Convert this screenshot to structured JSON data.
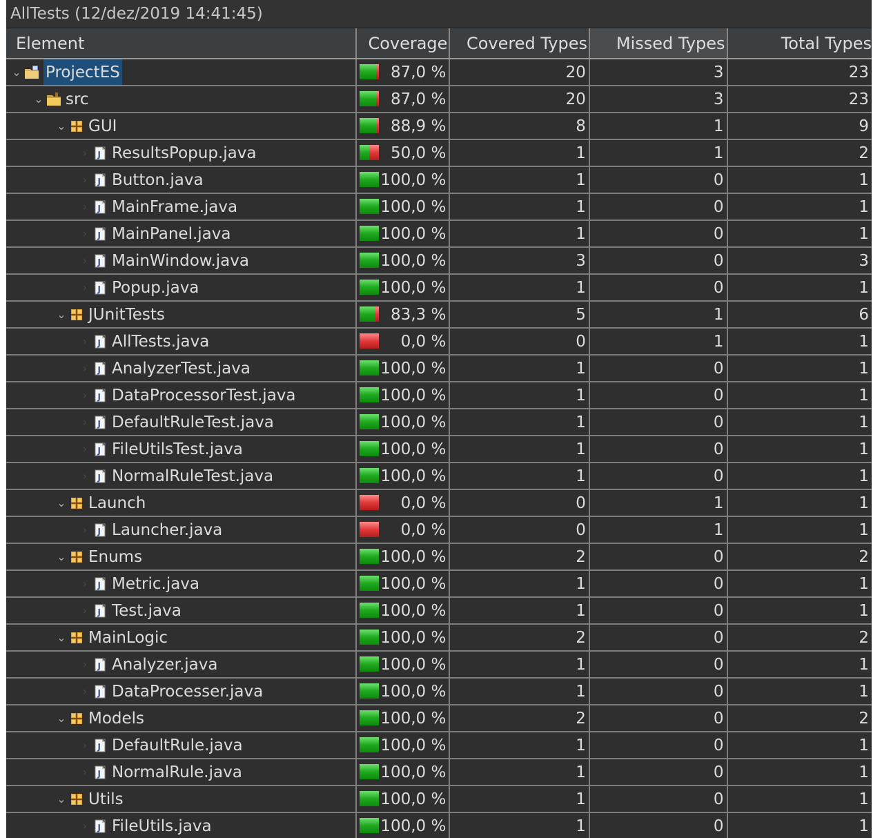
{
  "window": {
    "title": "AllTests (12/dez/2019 14:41:45)"
  },
  "columns": {
    "element": "Element",
    "coverage": "Coverage",
    "covered": "Covered Types",
    "missed": "Missed Types",
    "total": "Total Types",
    "sort_icon": "chevron-down-icon"
  },
  "colors": {
    "background": "#2f2f2f",
    "header": "#3c3f41",
    "text": "#dcdcdc",
    "covered": "#1faa1f",
    "missed": "#e03a3a",
    "selection": "#1d4f7a"
  },
  "rows": [
    {
      "name": "ProjectES",
      "type": "project",
      "level": 0,
      "expanded": true,
      "selected": true,
      "coverage": "87,0 %",
      "covered_fraction": 0.87,
      "covered": "20",
      "missed": "3",
      "total": "23"
    },
    {
      "name": "src",
      "type": "source-folder",
      "level": 1,
      "expanded": true,
      "coverage": "87,0 %",
      "covered_fraction": 0.87,
      "covered": "20",
      "missed": "3",
      "total": "23"
    },
    {
      "name": "GUI",
      "type": "package",
      "level": 2,
      "expanded": true,
      "coverage": "88,9 %",
      "covered_fraction": 0.889,
      "covered": "8",
      "missed": "1",
      "total": "9"
    },
    {
      "name": "ResultsPopup.java",
      "type": "java-file",
      "level": 3,
      "coverage": "50,0 %",
      "covered_fraction": 0.5,
      "covered": "1",
      "missed": "1",
      "total": "2"
    },
    {
      "name": "Button.java",
      "type": "java-file",
      "level": 3,
      "coverage": "100,0 %",
      "covered_fraction": 1,
      "covered": "1",
      "missed": "0",
      "total": "1"
    },
    {
      "name": "MainFrame.java",
      "type": "java-file",
      "level": 3,
      "coverage": "100,0 %",
      "covered_fraction": 1,
      "covered": "1",
      "missed": "0",
      "total": "1"
    },
    {
      "name": "MainPanel.java",
      "type": "java-file",
      "level": 3,
      "coverage": "100,0 %",
      "covered_fraction": 1,
      "covered": "1",
      "missed": "0",
      "total": "1"
    },
    {
      "name": "MainWindow.java",
      "type": "java-file",
      "level": 3,
      "coverage": "100,0 %",
      "covered_fraction": 1,
      "covered": "3",
      "missed": "0",
      "total": "3"
    },
    {
      "name": "Popup.java",
      "type": "java-file",
      "level": 3,
      "coverage": "100,0 %",
      "covered_fraction": 1,
      "covered": "1",
      "missed": "0",
      "total": "1"
    },
    {
      "name": "JUnitTests",
      "type": "package",
      "level": 2,
      "expanded": true,
      "coverage": "83,3 %",
      "covered_fraction": 0.833,
      "covered": "5",
      "missed": "1",
      "total": "6"
    },
    {
      "name": "AllTests.java",
      "type": "java-file",
      "level": 3,
      "coverage": "0,0 %",
      "covered_fraction": 0,
      "covered": "0",
      "missed": "1",
      "total": "1"
    },
    {
      "name": "AnalyzerTest.java",
      "type": "java-file",
      "level": 3,
      "coverage": "100,0 %",
      "covered_fraction": 1,
      "covered": "1",
      "missed": "0",
      "total": "1"
    },
    {
      "name": "DataProcessorTest.java",
      "type": "java-file",
      "level": 3,
      "coverage": "100,0 %",
      "covered_fraction": 1,
      "covered": "1",
      "missed": "0",
      "total": "1"
    },
    {
      "name": "DefaultRuleTest.java",
      "type": "java-file",
      "level": 3,
      "coverage": "100,0 %",
      "covered_fraction": 1,
      "covered": "1",
      "missed": "0",
      "total": "1"
    },
    {
      "name": "FileUtilsTest.java",
      "type": "java-file",
      "level": 3,
      "coverage": "100,0 %",
      "covered_fraction": 1,
      "covered": "1",
      "missed": "0",
      "total": "1"
    },
    {
      "name": "NormalRuleTest.java",
      "type": "java-file",
      "level": 3,
      "coverage": "100,0 %",
      "covered_fraction": 1,
      "covered": "1",
      "missed": "0",
      "total": "1"
    },
    {
      "name": "Launch",
      "type": "package",
      "level": 2,
      "expanded": true,
      "coverage": "0,0 %",
      "covered_fraction": 0,
      "covered": "0",
      "missed": "1",
      "total": "1"
    },
    {
      "name": "Launcher.java",
      "type": "java-file",
      "level": 3,
      "coverage": "0,0 %",
      "covered_fraction": 0,
      "covered": "0",
      "missed": "1",
      "total": "1"
    },
    {
      "name": "Enums",
      "type": "package",
      "level": 2,
      "expanded": true,
      "coverage": "100,0 %",
      "covered_fraction": 1,
      "covered": "2",
      "missed": "0",
      "total": "2"
    },
    {
      "name": "Metric.java",
      "type": "java-file",
      "level": 3,
      "coverage": "100,0 %",
      "covered_fraction": 1,
      "covered": "1",
      "missed": "0",
      "total": "1"
    },
    {
      "name": "Test.java",
      "type": "java-file",
      "level": 3,
      "coverage": "100,0 %",
      "covered_fraction": 1,
      "covered": "1",
      "missed": "0",
      "total": "1"
    },
    {
      "name": "MainLogic",
      "type": "package",
      "level": 2,
      "expanded": true,
      "coverage": "100,0 %",
      "covered_fraction": 1,
      "covered": "2",
      "missed": "0",
      "total": "2"
    },
    {
      "name": "Analyzer.java",
      "type": "java-file",
      "level": 3,
      "coverage": "100,0 %",
      "covered_fraction": 1,
      "covered": "1",
      "missed": "0",
      "total": "1"
    },
    {
      "name": "DataProcesser.java",
      "type": "java-file",
      "level": 3,
      "coverage": "100,0 %",
      "covered_fraction": 1,
      "covered": "1",
      "missed": "0",
      "total": "1"
    },
    {
      "name": "Models",
      "type": "package",
      "level": 2,
      "expanded": true,
      "coverage": "100,0 %",
      "covered_fraction": 1,
      "covered": "2",
      "missed": "0",
      "total": "2"
    },
    {
      "name": "DefaultRule.java",
      "type": "java-file",
      "level": 3,
      "coverage": "100,0 %",
      "covered_fraction": 1,
      "covered": "1",
      "missed": "0",
      "total": "1"
    },
    {
      "name": "NormalRule.java",
      "type": "java-file",
      "level": 3,
      "coverage": "100,0 %",
      "covered_fraction": 1,
      "covered": "1",
      "missed": "0",
      "total": "1"
    },
    {
      "name": "Utils",
      "type": "package",
      "level": 2,
      "expanded": true,
      "coverage": "100,0 %",
      "covered_fraction": 1,
      "covered": "1",
      "missed": "0",
      "total": "1"
    },
    {
      "name": "FileUtils.java",
      "type": "java-file",
      "level": 3,
      "coverage": "100,0 %",
      "covered_fraction": 1,
      "covered": "1",
      "missed": "0",
      "total": "1"
    }
  ]
}
